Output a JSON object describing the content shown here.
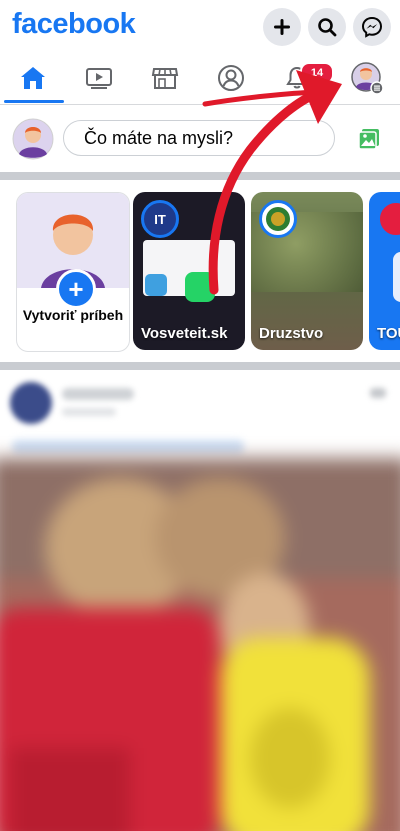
{
  "app": {
    "logo_text": "facebook",
    "brand_color": "#1877f2"
  },
  "topbar": {
    "buttons": [
      {
        "name": "create",
        "icon": "plus-icon"
      },
      {
        "name": "search",
        "icon": "search-icon"
      },
      {
        "name": "messenger",
        "icon": "messenger-icon"
      }
    ]
  },
  "navbar": {
    "tabs": [
      {
        "name": "home",
        "icon": "home-icon",
        "active": true
      },
      {
        "name": "watch",
        "icon": "video-icon"
      },
      {
        "name": "marketplace",
        "icon": "store-icon"
      },
      {
        "name": "profile",
        "icon": "user-icon"
      },
      {
        "name": "notifications",
        "icon": "bell-icon"
      },
      {
        "name": "menu",
        "icon": "avatar-menu-icon"
      }
    ],
    "notification_count": "14"
  },
  "composer": {
    "placeholder": "Čo máte na mysli?",
    "photo_icon": "photo-icon"
  },
  "stories": {
    "create_label": "Vytvoriť príbeh",
    "items": [
      {
        "name": "Vosveteit.sk",
        "avatar_text": "IT"
      },
      {
        "name": "Druzstvo"
      },
      {
        "name": "TOU"
      }
    ]
  },
  "annotation": {
    "arrow_color": "#e0192a"
  }
}
